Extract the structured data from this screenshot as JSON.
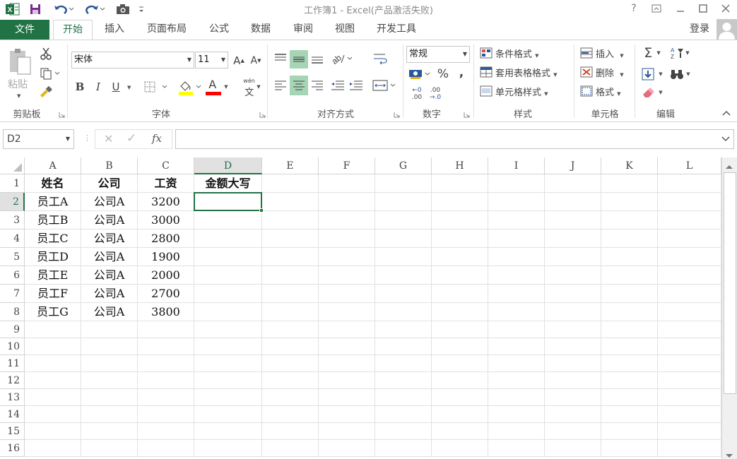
{
  "window": {
    "title": "工作簿1 - Excel(产品激活失败)",
    "help": "?",
    "controls": [
      "ribbon-display-icon",
      "minimize-icon",
      "maximize-icon",
      "close-icon"
    ]
  },
  "qat": {
    "icons": [
      "excel-logo-icon",
      "save-icon",
      "undo-icon",
      "redo-icon",
      "camera-icon",
      "customize-qat-icon"
    ]
  },
  "tabs": {
    "file": "文件",
    "items": [
      {
        "label": "开始",
        "active": true
      },
      {
        "label": "插入",
        "active": false
      },
      {
        "label": "页面布局",
        "active": false
      },
      {
        "label": "公式",
        "active": false
      },
      {
        "label": "数据",
        "active": false
      },
      {
        "label": "审阅",
        "active": false
      },
      {
        "label": "视图",
        "active": false
      },
      {
        "label": "开发工具",
        "active": false
      }
    ],
    "login": "登录"
  },
  "ribbon": {
    "clipboard": {
      "paste": "粘贴",
      "label": "剪贴板"
    },
    "font": {
      "font_name": "宋体",
      "font_size": "11",
      "grow": "A",
      "shrink": "A",
      "bold": "B",
      "italic": "I",
      "underline": "U",
      "font_color_glyph": "A",
      "pinyin_top": "wén",
      "pinyin_bottom": "文",
      "label": "字体",
      "fill_color": "#ffff00",
      "text_color": "#ff0000"
    },
    "alignment": {
      "label": "对齐方式",
      "highlight_color": "#a6d5b5"
    },
    "number": {
      "format": "常规",
      "percent": "%",
      "comma": ",",
      "inc_top": "←0",
      "inc_bottom": ".00",
      "dec_top": ".00",
      "dec_bottom": "→.0",
      "label": "数字"
    },
    "styles": {
      "conditional": "条件格式",
      "table": "套用表格格式",
      "cell_styles": "单元格样式",
      "label": "样式"
    },
    "cells": {
      "insert": "插入",
      "delete": "删除",
      "format": "格式",
      "label": "单元格"
    },
    "editing": {
      "sum": "Σ",
      "sort": "A↓Z",
      "label": "编辑"
    }
  },
  "formula_bar": {
    "name_box": "D2",
    "cancel": "✕",
    "enter": "✓",
    "fx": "fx",
    "value": ""
  },
  "sheet": {
    "columns": [
      "A",
      "B",
      "C",
      "D",
      "E",
      "F",
      "G",
      "H",
      "I",
      "J",
      "K",
      "L"
    ],
    "rows": [
      "1",
      "2",
      "3",
      "4",
      "5",
      "6",
      "7",
      "8",
      "9",
      "10",
      "11",
      "12",
      "13",
      "14",
      "15",
      "16"
    ],
    "selected_column": "D",
    "selected_row": "2",
    "header": [
      "姓名",
      "公司",
      "工资",
      "金额大写"
    ],
    "data": [
      [
        "员工A",
        "公司A",
        "3200",
        ""
      ],
      [
        "员工B",
        "公司A",
        "3000",
        ""
      ],
      [
        "员工C",
        "公司A",
        "2800",
        ""
      ],
      [
        "员工D",
        "公司A",
        "1900",
        ""
      ],
      [
        "员工E",
        "公司A",
        "2000",
        ""
      ],
      [
        "员工F",
        "公司A",
        "2700",
        ""
      ],
      [
        "员工G",
        "公司A",
        "3800",
        ""
      ]
    ]
  },
  "colors": {
    "accent": "#217346",
    "gridline": "#e1e1e1",
    "header_border": "#d4d4d4"
  }
}
